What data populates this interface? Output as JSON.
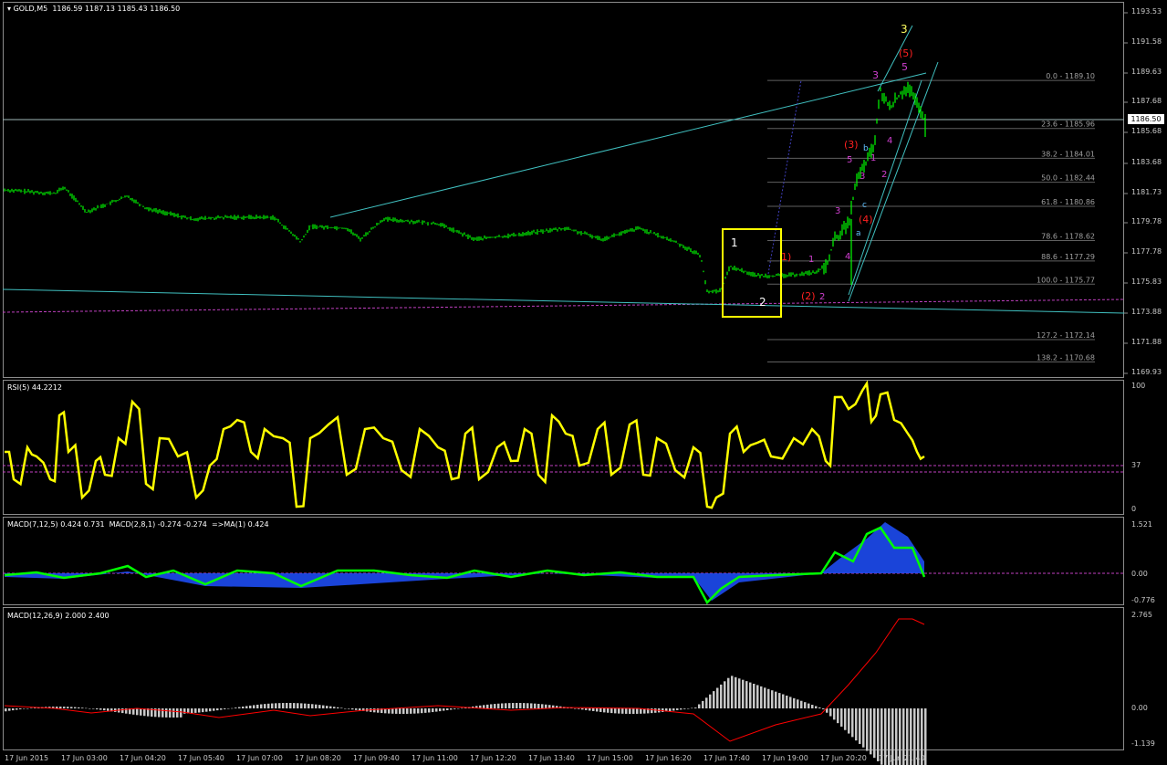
{
  "main": {
    "title": "GOLD,M5",
    "ohlc": "1186.59 1187.13 1185.43 1186.50",
    "y_labels": [
      "1193.53",
      "1191.58",
      "1189.63",
      "1187.68",
      "1185.68",
      "1183.68",
      "1181.73",
      "1179.78",
      "1177.78",
      "1175.83",
      "1173.88",
      "1171.88",
      "1169.93"
    ],
    "current_price": "1186.50",
    "fib_levels": [
      "0.0 - 1189.10",
      "23.6 - 1185.96",
      "38.2 - 1184.01",
      "50.0 - 1182.44",
      "61.8 - 1180.86",
      "78.6 - 1178.62",
      "88.6 - 1177.29",
      "100.0 - 1175.77",
      "127.2 - 1172.14",
      "138.2 - 1170.68"
    ],
    "wave_labels": {
      "w1": "1",
      "w2": "2",
      "w3": "3",
      "w5p": "(5)",
      "w1p": "1)",
      "w2p": "(2)",
      "w3p": "(3)",
      "w4p": "(4)",
      "m1": "1",
      "m2": "2",
      "m3": "3",
      "m4": "4",
      "m5": "5",
      "s3": "3",
      "s5": "5",
      "s4": "4",
      "s1": "1",
      "s2": "2",
      "s3b": "3",
      "a": "a",
      "b": "b",
      "c": "c"
    }
  },
  "rsi": {
    "title": "RSI(5) 44.2212",
    "y_labels": [
      "100",
      "37",
      "0"
    ]
  },
  "macd1": {
    "title": "MACD(7,12,5) 0.424 0.731  MACD(2,8,1) -0.274 -0.274  =>MA(1) 0.424",
    "y_labels": [
      "1.521",
      "0.00",
      "-0.776"
    ]
  },
  "macd2": {
    "title": "MACD(12,26,9) 2.000 2.400",
    "y_labels": [
      "2.765",
      "0.00",
      "-1.139"
    ]
  },
  "x_labels": [
    "17 Jun 2015",
    "17 Jun 03:00",
    "17 Jun 04:20",
    "17 Jun 05:40",
    "17 Jun 07:00",
    "17 Jun 08:20",
    "17 Jun 09:40",
    "17 Jun 11:00",
    "17 Jun 12:20",
    "17 Jun 13:40",
    "17 Jun 15:00",
    "17 Jun 16:20",
    "17 Jun 17:40",
    "17 Jun 19:00",
    "17 Jun 20:20",
    "17 Jun 21:40"
  ],
  "colors": {
    "candle": "#00ff00",
    "trendline": "#40c0c0",
    "rsi": "#ffff00",
    "macd_fast": "#00ff00",
    "macd_hist": "#1e50ff",
    "macd_signal": "#ff0000",
    "macd2_hist": "#c8c8c8",
    "fib": "#606060",
    "box": "#ffff00",
    "wave_red": "#ff2020",
    "wave_magenta": "#d040d0"
  }
}
